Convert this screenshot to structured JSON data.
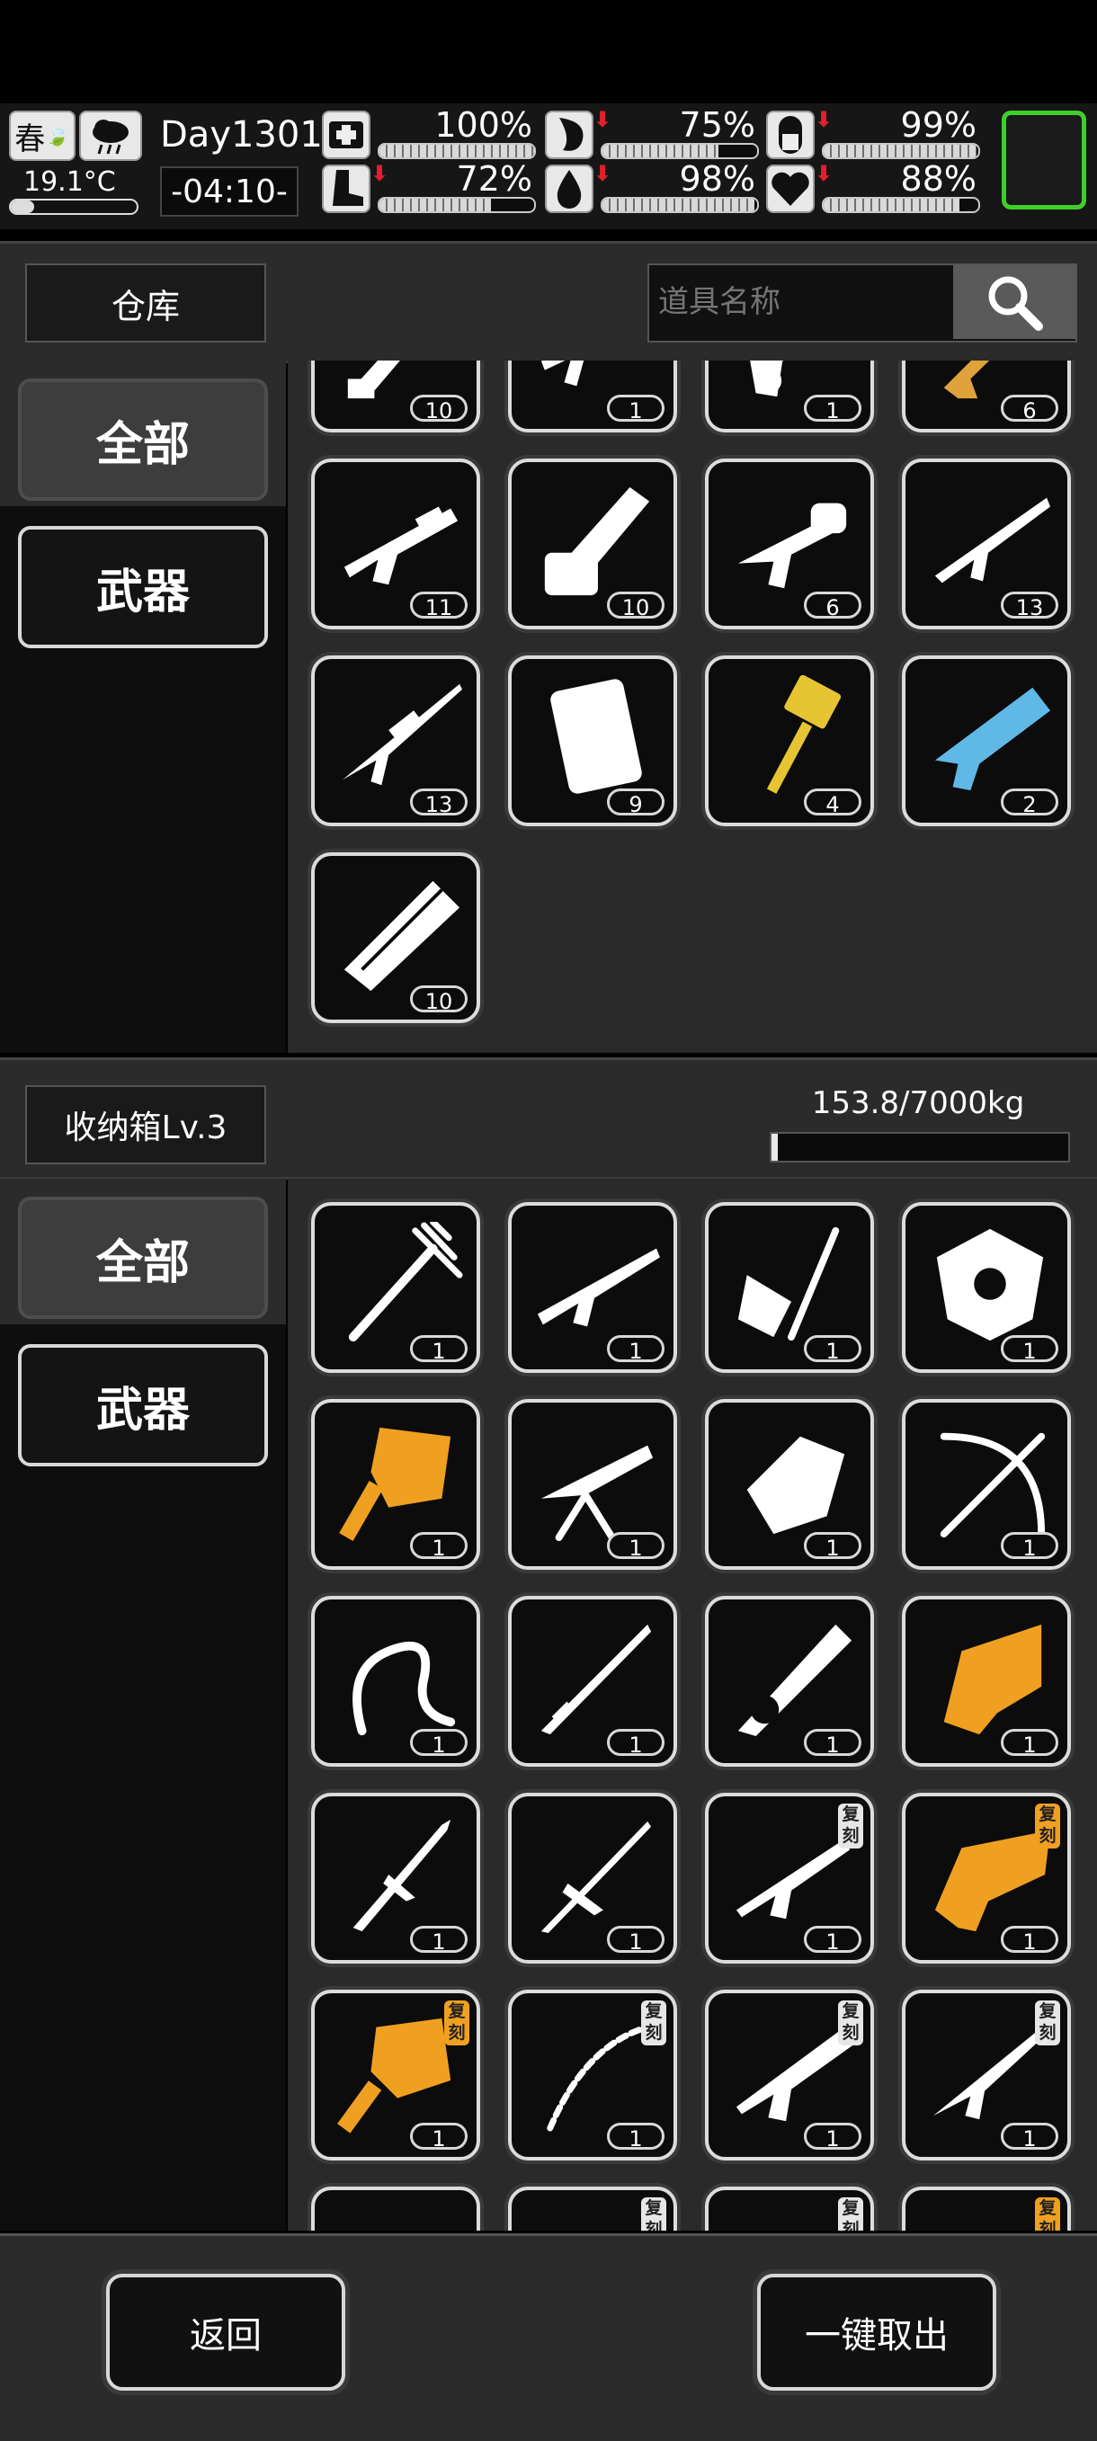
{
  "hud": {
    "season": "春",
    "temperature": "19.1°C",
    "day": "Day1301",
    "time": "-04:10-",
    "stats": [
      {
        "icon": "medkit-icon",
        "value": "100%",
        "level": 1.0,
        "warn": false
      },
      {
        "icon": "stomach-icon",
        "value": "75%",
        "level": 0.75,
        "warn": true
      },
      {
        "icon": "pill-icon",
        "value": "99%",
        "level": 0.99,
        "warn": true
      },
      {
        "icon": "boot-icon",
        "value": "72%",
        "level": 0.72,
        "warn": true
      },
      {
        "icon": "water-drop-icon",
        "value": "98%",
        "level": 0.98,
        "warn": true
      },
      {
        "icon": "heart-icon",
        "value": "88%",
        "level": 0.88,
        "warn": true
      }
    ],
    "warn_color": "#e0202c",
    "accent_green": "#3ecf2b"
  },
  "warehouse": {
    "title": "仓库",
    "search_placeholder": "道具名称",
    "categories": [
      "全部",
      "武器"
    ],
    "items": [
      {
        "icon": "knife-icon",
        "count": "10",
        "color": "#ffffff"
      },
      {
        "icon": "rifle-icon",
        "count": "1",
        "color": "#ffffff"
      },
      {
        "icon": "heavy-gun-icon",
        "count": "1",
        "color": "#ffffff"
      },
      {
        "icon": "gold-rifle-icon",
        "count": "6",
        "color": "#e0a23a"
      },
      {
        "icon": "shotgun-icon",
        "count": "11",
        "color": "#ffffff"
      },
      {
        "icon": "chainsaw-icon",
        "count": "10",
        "color": "#ffffff"
      },
      {
        "icon": "grenade-launcher-icon",
        "count": "6",
        "color": "#ffffff"
      },
      {
        "icon": "assault-rifle-icon",
        "count": "13",
        "color": "#ffffff"
      },
      {
        "icon": "sniper-rifle-icon",
        "count": "13",
        "color": "#ffffff"
      },
      {
        "icon": "riot-shield-icon",
        "count": "9",
        "color": "#ffffff"
      },
      {
        "icon": "hammer-icon",
        "count": "4",
        "color": "#e7c532"
      },
      {
        "icon": "plasma-gun-icon",
        "count": "2",
        "color": "#5fb8e6"
      },
      {
        "icon": "minigun-icon",
        "count": "10",
        "color": "#ffffff"
      }
    ]
  },
  "storage": {
    "title": "收纳箱Lv.3",
    "weight": "153.8/7000kg",
    "weight_fraction": 0.022,
    "categories": [
      "全部",
      "武器"
    ],
    "copy_tag": "复刻",
    "items": [
      {
        "icon": "pitchfork-icon",
        "count": "1",
        "color": "#ffffff",
        "tag": false
      },
      {
        "icon": "machine-gun-icon",
        "count": "1",
        "color": "#ffffff",
        "tag": false
      },
      {
        "icon": "shovel-icon",
        "count": "1",
        "color": "#ffffff",
        "tag": false
      },
      {
        "icon": "shield-icon",
        "count": "1",
        "color": "#ffffff",
        "tag": false
      },
      {
        "icon": "dragon-mace-icon",
        "count": "1",
        "color": "#f0a020",
        "tag": false
      },
      {
        "icon": "mounted-gun-icon",
        "count": "1",
        "color": "#ffffff",
        "tag": false
      },
      {
        "icon": "gauntlet-icon",
        "count": "1",
        "color": "#ffffff",
        "tag": false
      },
      {
        "icon": "crossbow-icon",
        "count": "1",
        "color": "#ffffff",
        "tag": false
      },
      {
        "icon": "whip-icon",
        "count": "1",
        "color": "#ffffff",
        "tag": false
      },
      {
        "icon": "katana-icon",
        "count": "1",
        "color": "#ffffff",
        "tag": false
      },
      {
        "icon": "chainsaw-sword-icon",
        "count": "1",
        "color": "#ffffff",
        "tag": false
      },
      {
        "icon": "dragon-cannon-icon",
        "count": "1",
        "color": "#f0a020",
        "tag": false
      },
      {
        "icon": "spear-icon",
        "count": "1",
        "color": "#ffffff",
        "tag": false
      },
      {
        "icon": "lance-icon",
        "count": "1",
        "color": "#ffffff",
        "tag": false
      },
      {
        "icon": "ornate-rifle-icon",
        "count": "1",
        "color": "#ffffff",
        "tag": true
      },
      {
        "icon": "gold-cannon-icon",
        "count": "1",
        "color": "#f0a020",
        "tag": true
      },
      {
        "icon": "gold-mace-icon",
        "count": "1",
        "color": "#f0a020",
        "tag": true
      },
      {
        "icon": "chain-whip-icon",
        "count": "1",
        "color": "#ffffff",
        "tag": true
      },
      {
        "icon": "dragon-rifle-icon",
        "count": "1",
        "color": "#ffffff",
        "tag": true
      },
      {
        "icon": "long-rifle-icon",
        "count": "1",
        "color": "#ffffff",
        "tag": true
      },
      {
        "icon": "partial-item-icon",
        "count": "",
        "color": "#ffffff",
        "tag": false
      },
      {
        "icon": "partial-item-icon",
        "count": "",
        "color": "#ffffff",
        "tag": true
      },
      {
        "icon": "partial-item-icon",
        "count": "",
        "color": "#ffffff",
        "tag": true
      },
      {
        "icon": "partial-item-icon",
        "count": "",
        "color": "#f0c020",
        "tag": true
      }
    ]
  },
  "footer": {
    "back_label": "返回",
    "take_all_label": "一键取出"
  }
}
